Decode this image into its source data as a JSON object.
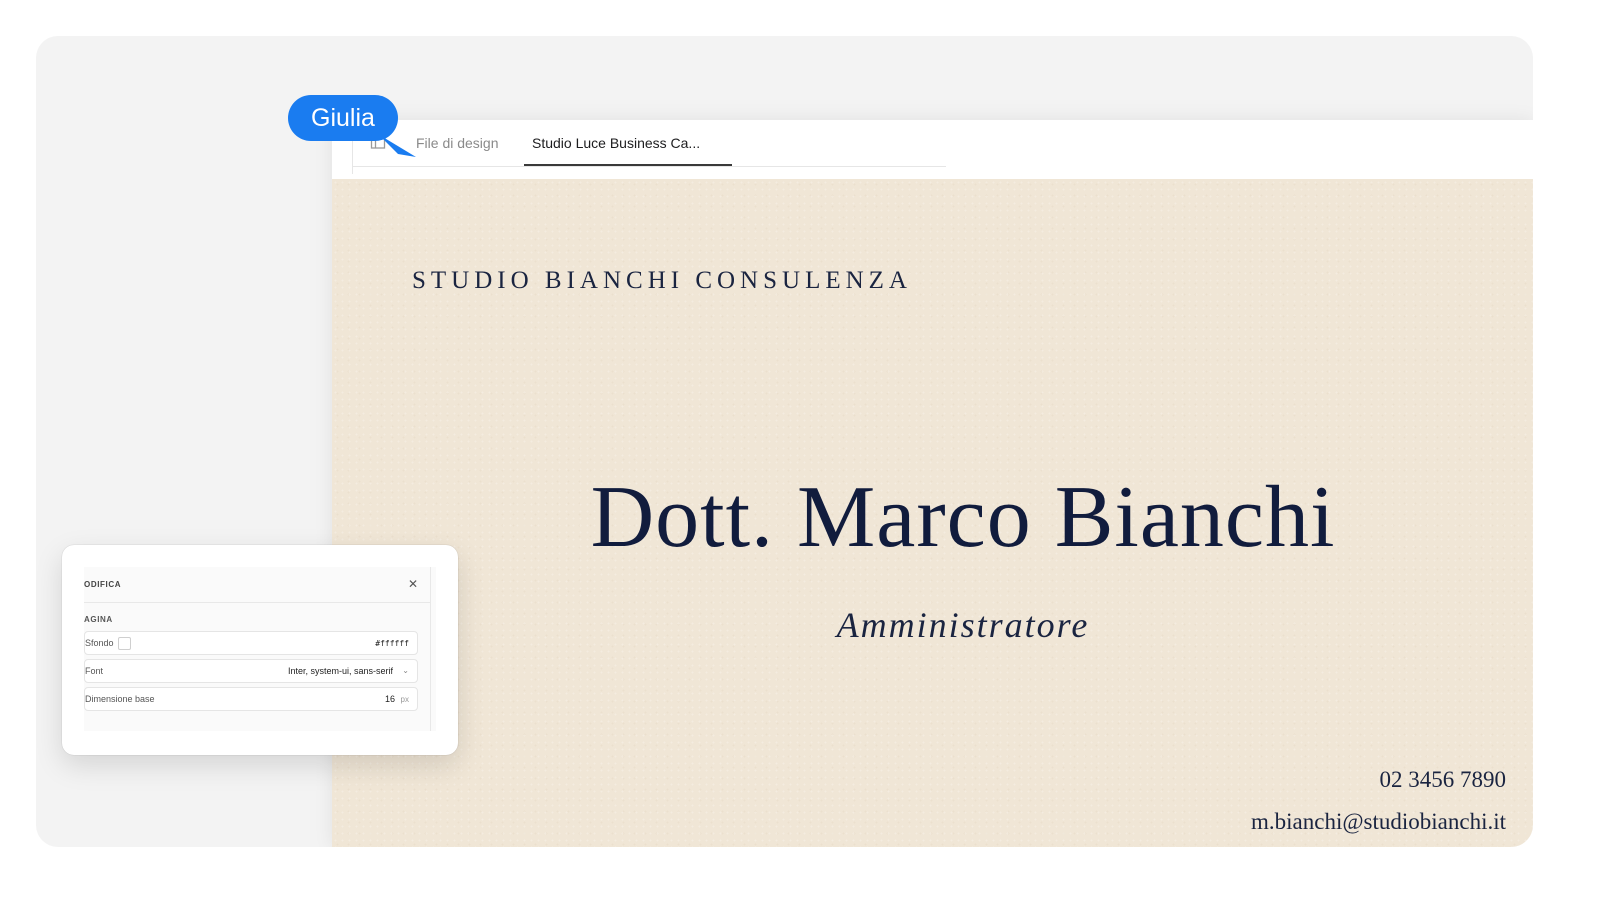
{
  "tabs": {
    "design_files": "File di design",
    "current_file": "Studio Luce Business Ca..."
  },
  "collaborator": {
    "name": "Giulia",
    "color": "#1a7cf0"
  },
  "card": {
    "company": "STUDIO BIANCHI CONSULENZA",
    "name": "Dott. Marco Bianchi",
    "role": "Amministratore",
    "phone": "02 3456 7890",
    "email": "m.bianchi@studiobianchi.it",
    "background_color": "#f0e6d6",
    "text_color": "#14203f"
  },
  "panel": {
    "title": "ODIFICA",
    "close_icon": "close-icon",
    "section": "AGINA",
    "background_label": "Sfondo",
    "background_value": "#ffffff",
    "font_label": "Font",
    "font_value": "Inter, system-ui, sans-serif",
    "base_size_label": "Dimensione base",
    "base_size_value": "16",
    "base_size_unit": "px"
  }
}
